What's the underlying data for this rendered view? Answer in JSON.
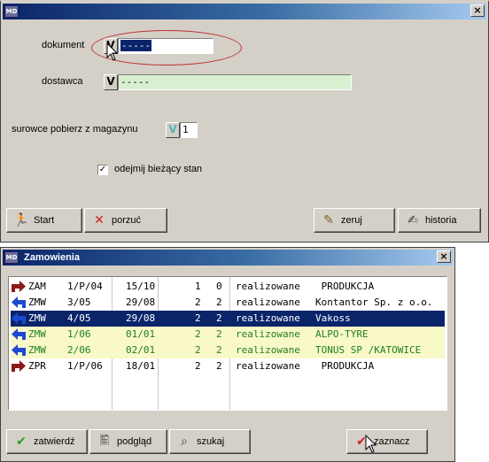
{
  "window1": {
    "title_icon": "MD",
    "close": "×",
    "dokument_label": "dokument",
    "dokument_value": "-----",
    "dostawca_label": "dostawca",
    "dostawca_value": "-----",
    "surowce_label": "surowce pobierz z magazynu",
    "magazyn_value": "1",
    "odejmij_label": "odejmij bieżący stan",
    "odejmij_checked": "✓",
    "v_glyph": "V",
    "buttons": {
      "start": "Start",
      "porzuc": "porzuć",
      "zeruj": "zeruj",
      "historia": "historia"
    }
  },
  "window2": {
    "title_icon": "MD",
    "title": "Zamowienia",
    "close": "×",
    "rows": [
      {
        "code": "ZAM",
        "num": "1/P/04",
        "date": "15/10",
        "a": "1",
        "b": "0",
        "status": "realizowane",
        "name": " PRODUKCJA",
        "dir": "out",
        "style": "normal"
      },
      {
        "code": "ZMW",
        "num": "3/05",
        "date": "29/08",
        "a": "2",
        "b": "2",
        "status": "realizowane",
        "name": "Kontantor Sp. z o.o.",
        "dir": "in",
        "style": "normal"
      },
      {
        "code": "ZMW",
        "num": "4/05",
        "date": "29/08",
        "a": "2",
        "b": "2",
        "status": "realizowane",
        "name": "Vakoss",
        "dir": "in",
        "style": "selected"
      },
      {
        "code": "ZMW",
        "num": "1/06",
        "date": "01/01",
        "a": "2",
        "b": "2",
        "status": "realizowane",
        "name": "ALPO-TYRE",
        "dir": "in",
        "style": "green"
      },
      {
        "code": "ZMW",
        "num": "2/06",
        "date": "02/01",
        "a": "2",
        "b": "2",
        "status": "realizowane",
        "name": "TONUS SP /KATOWICE",
        "dir": "in",
        "style": "green"
      },
      {
        "code": "ZPR",
        "num": "1/P/06",
        "date": "18/01",
        "a": "2",
        "b": "2",
        "status": "realizowane",
        "name": " PRODUKCJA",
        "dir": "out",
        "style": "normal"
      }
    ],
    "buttons": {
      "zatwierdz": "zatwierdź",
      "podglad": "podgląd",
      "szukaj": "szukaj",
      "zaznacz": "zaznacz"
    }
  },
  "colors": {
    "arrow_out": "#8b1a1a",
    "arrow_in": "#1a4ad0",
    "ellipse": "#c03030"
  }
}
